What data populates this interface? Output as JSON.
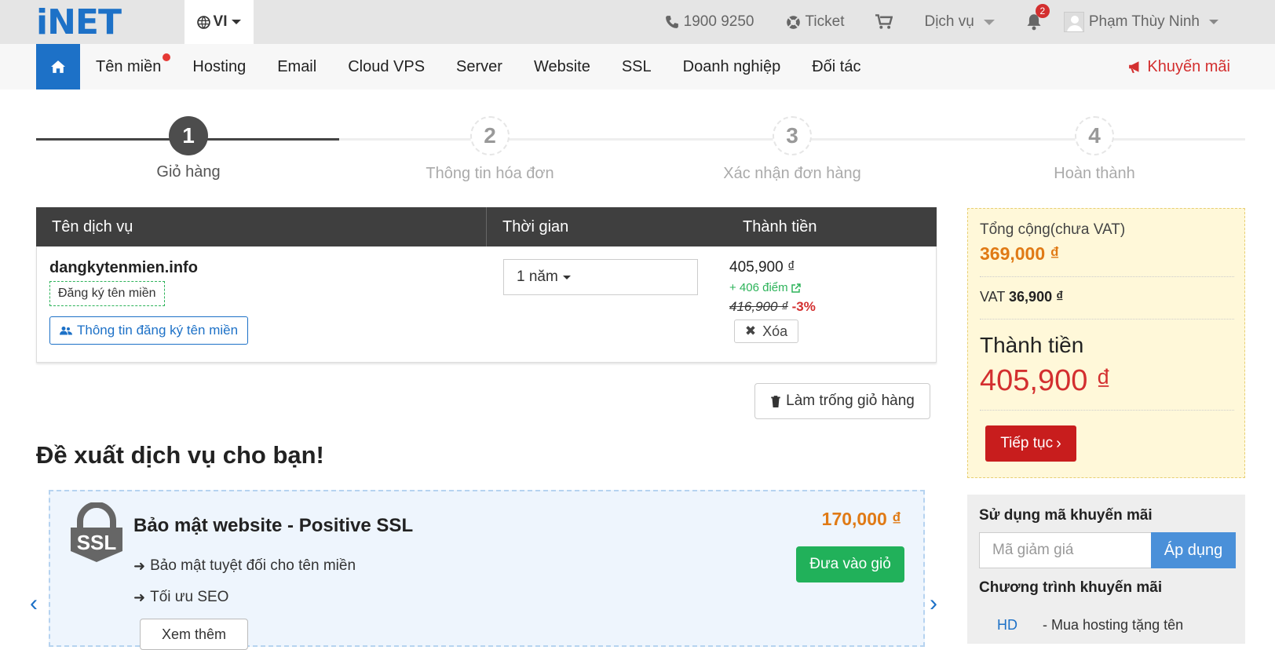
{
  "header": {
    "logo_text": "iNET",
    "language": "VI",
    "phone": "1900 9250",
    "ticket": "Ticket",
    "services_menu": "Dịch vụ",
    "notification_count": "2",
    "user_name": "Phạm Thùy Ninh"
  },
  "nav": {
    "items": [
      "Tên miền",
      "Hosting",
      "Email",
      "Cloud VPS",
      "Server",
      "Website",
      "SSL",
      "Doanh nghiệp",
      "Đối tác"
    ],
    "promo": "Khuyến mãi"
  },
  "steps": [
    {
      "num": "1",
      "label": "Giỏ hàng"
    },
    {
      "num": "2",
      "label": "Thông tin hóa đơn"
    },
    {
      "num": "3",
      "label": "Xác nhận đơn hàng"
    },
    {
      "num": "4",
      "label": "Hoàn thành"
    }
  ],
  "cart": {
    "headers": [
      "Tên dịch vụ",
      "Thời gian",
      "Thành tiền"
    ],
    "item": {
      "domain": "dangkytenmien.info",
      "tag": "Đăng ký tên miền",
      "info_button": "Thông tin đăng ký tên miền",
      "period": "1 năm",
      "price": "405,900 ₫",
      "points": "+ 406 điểm",
      "old_price": "416,900 ₫",
      "discount": "-3%",
      "remove": "Xóa"
    },
    "empty_button": "Làm trống giỏ hàng"
  },
  "recommend": {
    "title": "Đề xuất dịch vụ cho bạn!",
    "icon_text": "SSL",
    "name": "Bảo mật website - Positive SSL",
    "features": [
      "Bảo mật tuyệt đối cho tên miền",
      "Tối ưu SEO"
    ],
    "price": "170,000 ₫",
    "add_button": "Đưa vào giỏ",
    "more_button": "Xem thêm"
  },
  "summary": {
    "subtotal_label": "Tổng cộng(chưa VAT)",
    "subtotal": "369,000 ₫",
    "vat_label": "VAT",
    "vat": "36,900 ₫",
    "total_label": "Thành tiền",
    "total": "405,900 ₫",
    "continue": "Tiếp tục"
  },
  "promo_box": {
    "title": "Sử dụng mã khuyến mãi",
    "placeholder": "Mã giảm giá",
    "apply": "Áp dụng",
    "program_title": "Chương trình khuyến mãi",
    "program_code": "HD",
    "program_desc": "- Mua hosting tặng tên"
  },
  "colors": {
    "brand_blue": "#1d71c7",
    "red": "#d32f2f",
    "green": "#21b15a",
    "orange": "#e07a15"
  }
}
